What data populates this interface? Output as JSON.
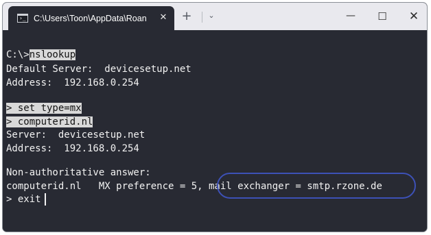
{
  "titlebar": {
    "tab_title": "C:\\Users\\Toon\\AppData\\Roan",
    "tab_icon": "terminal-icon",
    "tab_close": "✕",
    "new_tab": "+",
    "dropdown": "⌄",
    "minimize": "—",
    "maximize": "☐",
    "close": "✕"
  },
  "terminal": {
    "lines": [
      {
        "prefix": "C:\\>",
        "selected": "nslookup",
        "rest": ""
      },
      {
        "prefix": "Default Server:  devicesetup.net",
        "selected": "",
        "rest": ""
      },
      {
        "prefix": "Address:  192.168.0.254",
        "selected": "",
        "rest": ""
      },
      {
        "prefix": "",
        "selected": "> set type=mx",
        "rest": ""
      },
      {
        "prefix": "",
        "selected": "> computerid.nl",
        "rest": ""
      },
      {
        "prefix": "Server:  devicesetup.net",
        "selected": "",
        "rest": ""
      },
      {
        "prefix": "Address:  192.168.0.254",
        "selected": "",
        "rest": ""
      },
      {
        "prefix": "Non-authoritative answer:",
        "selected": "",
        "rest": ""
      },
      {
        "prefix": "computerid.nl   MX preference = 5, mail exchanger = smtp.rzone.de",
        "selected": "",
        "rest": ""
      },
      {
        "prefix": "> exit",
        "selected": "",
        "rest": ""
      }
    ]
  },
  "colors": {
    "terminal_bg": "#282a33",
    "text": "#f2f2f2",
    "selection_bg": "#d9d9d9",
    "highlight_oval": "#3d51b7"
  }
}
